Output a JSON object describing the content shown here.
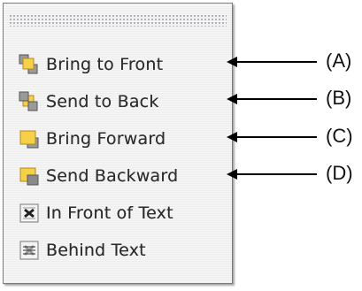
{
  "menu": {
    "items": [
      {
        "label": "Bring to Front",
        "icon": "bring-to-front-icon"
      },
      {
        "label": "Send to Back",
        "icon": "send-to-back-icon"
      },
      {
        "label": "Bring Forward",
        "icon": "bring-forward-icon"
      },
      {
        "label": "Send Backward",
        "icon": "send-backward-icon"
      },
      {
        "label": "In Front of Text",
        "icon": "in-front-of-text-icon"
      },
      {
        "label": "Behind Text",
        "icon": "behind-text-icon"
      }
    ]
  },
  "callouts": [
    "(A)",
    "(B)",
    "(C)",
    "(D)"
  ],
  "colors": {
    "yellow": "#f7d04a",
    "gray": "#8a8a8a",
    "border": "#7a7a7a",
    "arrow": "#000000"
  }
}
